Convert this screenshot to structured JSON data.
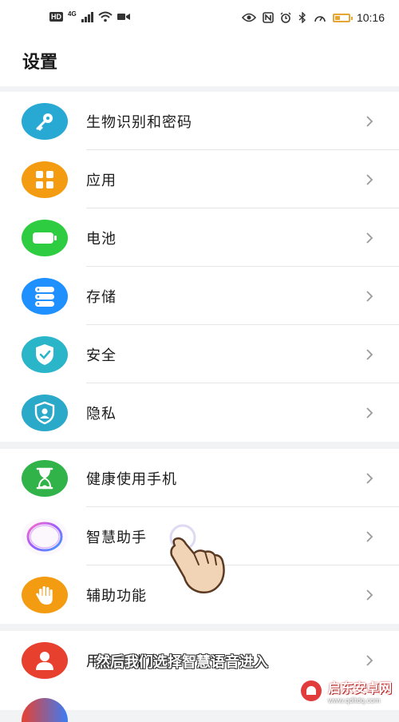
{
  "status_bar": {
    "hd": "HD",
    "network": "4G",
    "time": "10:16",
    "battery_level_percent": 40,
    "icons": [
      "eye-icon",
      "nfc-icon",
      "alarm-icon",
      "bluetooth-icon",
      "speedometer-icon",
      "battery-icon"
    ]
  },
  "header": {
    "title": "设置"
  },
  "groups": [
    {
      "items": [
        {
          "label": "生物识别和密码",
          "icon": "key-icon",
          "color": "#27a9d3"
        },
        {
          "label": "应用",
          "icon": "apps-grid-icon",
          "color": "#f39c12"
        },
        {
          "label": "电池",
          "icon": "battery-icon",
          "color": "#2ecc40"
        },
        {
          "label": "存储",
          "icon": "storage-icon",
          "color": "#1e90ff"
        },
        {
          "label": "安全",
          "icon": "shield-check-icon",
          "color": "#2ab5c9"
        },
        {
          "label": "隐私",
          "icon": "privacy-user-icon",
          "color": "#2aa9c9"
        }
      ]
    },
    {
      "items": [
        {
          "label": "健康使用手机",
          "icon": "hourglass-icon",
          "color": "#32b34a"
        },
        {
          "label": "智慧助手",
          "icon": "assistant-orb-icon",
          "color": "#c77dff"
        },
        {
          "label": "辅助功能",
          "icon": "hand-icon",
          "color": "#f39c12"
        }
      ]
    },
    {
      "items": [
        {
          "label": "用户和帐户",
          "icon": "user-icon",
          "color": "#e8402f"
        }
      ]
    }
  ],
  "overlay": {
    "subtitle": "然后我们选择智慧语音进入",
    "watermark_title": "启东安卓网",
    "watermark_url": "www.qdltdq.com"
  }
}
